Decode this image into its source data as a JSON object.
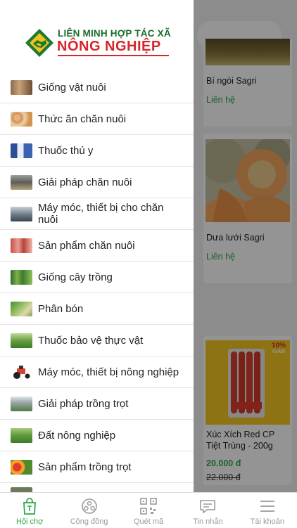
{
  "brand": {
    "line1": "LIÊN MINH HỢP TÁC XÃ",
    "line2": "NÔNG NGHIỆP",
    "green": "#1a6b2c",
    "red": "#d6262b",
    "yellow": "#f2c11c"
  },
  "menu": [
    {
      "label": "Giống vật nuôi",
      "icon": "livestock-thumb-icon"
    },
    {
      "label": "Thức ăn chăn nuôi",
      "icon": "feed-thumb-icon"
    },
    {
      "label": "Thuốc thú y",
      "icon": "vet-medicine-thumb-icon"
    },
    {
      "label": "Giải pháp chăn nuôi",
      "icon": "farm-solution-thumb-icon"
    },
    {
      "label": "Máy móc, thiết bị cho chăn nuôi",
      "icon": "livestock-machine-thumb-icon"
    },
    {
      "label": "Sản phẩm chăn nuôi",
      "icon": "livestock-product-thumb-icon"
    },
    {
      "label": "Giống cây trồng",
      "icon": "seedling-thumb-icon"
    },
    {
      "label": "Phân bón",
      "icon": "fertilizer-thumb-icon"
    },
    {
      "label": "Thuốc bảo vệ thực vật",
      "icon": "pesticide-thumb-icon"
    },
    {
      "label": "Máy móc, thiết bị nông nghiệp",
      "icon": "tractor-thumb-icon"
    },
    {
      "label": "Giải pháp trồng trọt",
      "icon": "greenhouse-thumb-icon"
    },
    {
      "label": "Đất nông nghiệp",
      "icon": "farmland-thumb-icon"
    },
    {
      "label": "Sản phẩm trồng trọt",
      "icon": "produce-thumb-icon"
    }
  ],
  "products": [
    {
      "name": "Bí ngòi Sagri",
      "contact": "Liên hệ"
    },
    {
      "name": "Dưa lưới Sagri",
      "contact": "Liên hệ"
    },
    {
      "name": "Xúc Xích Red CP Tiệt Trùng - 200g",
      "price": "20.000 đ",
      "old_price": "22.000 đ",
      "badge_pct": "10%",
      "badge_word": "GIẢM"
    }
  ],
  "nav": [
    {
      "label": "Hội chợ",
      "icon": "shop-bag-icon",
      "active": true
    },
    {
      "label": "Cộng đồng",
      "icon": "community-icon",
      "active": false
    },
    {
      "label": "Quét mã",
      "icon": "qr-code-icon",
      "active": false
    },
    {
      "label": "Tin nhắn",
      "icon": "chat-icon",
      "active": false
    },
    {
      "label": "Tài khoản",
      "icon": "menu-lines-icon",
      "active": false
    }
  ]
}
